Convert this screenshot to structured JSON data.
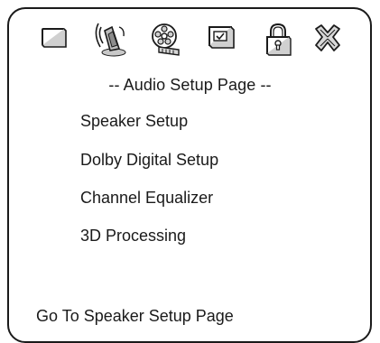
{
  "toolbar": {
    "icons": [
      {
        "name": "general-setup-icon",
        "kind": "tv-screen"
      },
      {
        "name": "audio-setup-icon",
        "kind": "speaker-with-waves"
      },
      {
        "name": "video-setup-icon",
        "kind": "film-reel"
      },
      {
        "name": "preference-icon",
        "kind": "checkbox-screen"
      },
      {
        "name": "password-icon",
        "kind": "padlock"
      },
      {
        "name": "exit-icon",
        "kind": "x-mark"
      }
    ],
    "selected": "audio-setup-icon"
  },
  "page": {
    "title": "-- Audio Setup Page --"
  },
  "menu": {
    "items": [
      {
        "label": "Speaker Setup"
      },
      {
        "label": "Dolby Digital Setup"
      },
      {
        "label": "Channel Equalizer"
      },
      {
        "label": "3D Processing"
      }
    ]
  },
  "status": {
    "text": "Go To Speaker Setup Page"
  },
  "colors": {
    "ink": "#1a1a1a",
    "background": "#ffffff",
    "icon_fill": "#c8c8c8"
  }
}
